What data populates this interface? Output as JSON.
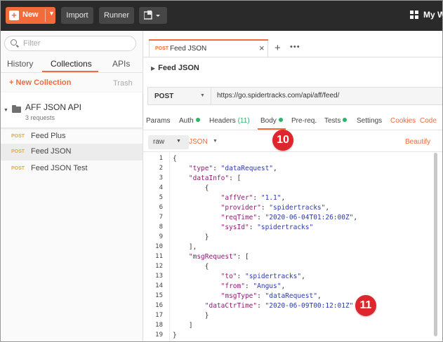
{
  "topbar": {
    "new_label": "New",
    "import_label": "Import",
    "runner_label": "Runner",
    "workspace_label": "My W"
  },
  "sidebar": {
    "filter_placeholder": "Filter",
    "tabs": [
      "History",
      "Collections",
      "APIs"
    ],
    "active_tab": "Collections",
    "new_collection_label": "+ New Collection",
    "trash_label": "Trash",
    "collection": {
      "name": "AFF JSON API",
      "count": "3 requests"
    },
    "requests": [
      {
        "method": "POST",
        "name": "Feed Plus",
        "selected": false
      },
      {
        "method": "POST",
        "name": "Feed JSON",
        "selected": true
      },
      {
        "method": "POST",
        "name": "Feed JSON Test",
        "selected": false
      }
    ]
  },
  "request_tab": {
    "method": "POST",
    "name": "Feed JSON",
    "close": "×"
  },
  "new_tab_plus": "+",
  "more_tabs": "•••",
  "breadcrumb": "Feed JSON",
  "request": {
    "method": "POST",
    "url": "https://go.spidertracks.com/api/aff/feed/"
  },
  "subtabs": {
    "params": "Params",
    "auth": "Auth",
    "headers": "Headers",
    "headers_count": "(11)",
    "body": "Body",
    "prereq": "Pre-req.",
    "tests": "Tests",
    "settings": "Settings",
    "cookies": "Cookies",
    "code": "Code"
  },
  "body_options": {
    "mode": "raw",
    "format": "JSON",
    "beautify": "Beautify"
  },
  "annotations": {
    "badge1": "10",
    "badge2": "11"
  },
  "colors": {
    "accent": "#f26b3a",
    "topbar": "#2a2a2a",
    "status_dot": "#2bb46a",
    "badge": "#e0262d"
  },
  "code_lines": [
    {
      "n": "1",
      "parts": [
        {
          "t": "{",
          "c": ""
        }
      ]
    },
    {
      "n": "2",
      "parts": [
        {
          "t": "    ",
          "c": ""
        },
        {
          "t": "\"type\"",
          "c": "k"
        },
        {
          "t": ": ",
          "c": ""
        },
        {
          "t": "\"dataRequest\"",
          "c": "s"
        },
        {
          "t": ",",
          "c": ""
        }
      ]
    },
    {
      "n": "3",
      "parts": [
        {
          "t": "    ",
          "c": ""
        },
        {
          "t": "\"dataInfo\"",
          "c": "k"
        },
        {
          "t": ": [",
          "c": ""
        }
      ]
    },
    {
      "n": "4",
      "parts": [
        {
          "t": "        {",
          "c": ""
        }
      ]
    },
    {
      "n": "5",
      "parts": [
        {
          "t": "            ",
          "c": ""
        },
        {
          "t": "\"affVer\"",
          "c": "k"
        },
        {
          "t": ": ",
          "c": ""
        },
        {
          "t": "\"1.1\"",
          "c": "s"
        },
        {
          "t": ",",
          "c": ""
        }
      ]
    },
    {
      "n": "6",
      "parts": [
        {
          "t": "            ",
          "c": ""
        },
        {
          "t": "\"provider\"",
          "c": "k"
        },
        {
          "t": ": ",
          "c": ""
        },
        {
          "t": "\"spidertracks\"",
          "c": "s"
        },
        {
          "t": ",",
          "c": ""
        }
      ]
    },
    {
      "n": "7",
      "parts": [
        {
          "t": "            ",
          "c": ""
        },
        {
          "t": "\"reqTime\"",
          "c": "k"
        },
        {
          "t": ": ",
          "c": ""
        },
        {
          "t": "\"2020-06-04T01:26:00Z\"",
          "c": "s"
        },
        {
          "t": ",",
          "c": ""
        }
      ]
    },
    {
      "n": "8",
      "parts": [
        {
          "t": "            ",
          "c": ""
        },
        {
          "t": "\"sysId\"",
          "c": "k"
        },
        {
          "t": ": ",
          "c": ""
        },
        {
          "t": "\"spidertracks\"",
          "c": "s"
        }
      ]
    },
    {
      "n": "9",
      "parts": [
        {
          "t": "        }",
          "c": ""
        }
      ]
    },
    {
      "n": "10",
      "parts": [
        {
          "t": "    ],",
          "c": ""
        }
      ]
    },
    {
      "n": "11",
      "parts": [
        {
          "t": "    ",
          "c": ""
        },
        {
          "t": "\"msgRequest\"",
          "c": "k"
        },
        {
          "t": ": [",
          "c": ""
        }
      ]
    },
    {
      "n": "12",
      "parts": [
        {
          "t": "        {",
          "c": ""
        }
      ]
    },
    {
      "n": "13",
      "parts": [
        {
          "t": "            ",
          "c": ""
        },
        {
          "t": "\"to\"",
          "c": "k"
        },
        {
          "t": ": ",
          "c": ""
        },
        {
          "t": "\"spidertracks\"",
          "c": "s"
        },
        {
          "t": ",",
          "c": ""
        }
      ]
    },
    {
      "n": "14",
      "parts": [
        {
          "t": "            ",
          "c": ""
        },
        {
          "t": "\"from\"",
          "c": "k"
        },
        {
          "t": ": ",
          "c": ""
        },
        {
          "t": "\"Angus\"",
          "c": "s"
        },
        {
          "t": ",",
          "c": ""
        }
      ]
    },
    {
      "n": "15",
      "parts": [
        {
          "t": "            ",
          "c": ""
        },
        {
          "t": "\"msgType\"",
          "c": "k"
        },
        {
          "t": ": ",
          "c": ""
        },
        {
          "t": "\"dataRequest\"",
          "c": "s"
        },
        {
          "t": ",",
          "c": ""
        }
      ]
    },
    {
      "n": "16",
      "parts": [
        {
          "t": "        ",
          "c": ""
        },
        {
          "t": "\"dataCtrTime\"",
          "c": "k"
        },
        {
          "t": ": ",
          "c": ""
        },
        {
          "t": "\"2020-06-09T00:12:01Z\"",
          "c": "s"
        }
      ]
    },
    {
      "n": "17",
      "parts": [
        {
          "t": "        }",
          "c": ""
        }
      ]
    },
    {
      "n": "18",
      "parts": [
        {
          "t": "    ]",
          "c": ""
        }
      ]
    },
    {
      "n": "19",
      "parts": [
        {
          "t": "}",
          "c": ""
        }
      ]
    }
  ]
}
